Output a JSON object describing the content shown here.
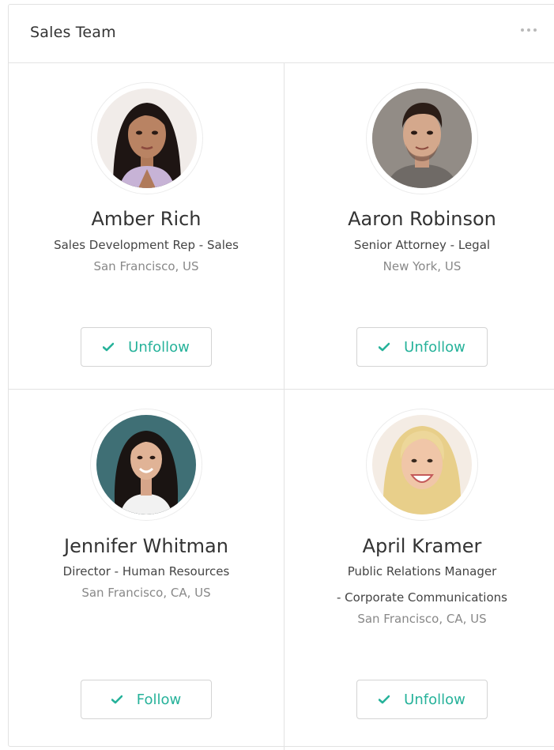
{
  "widget": {
    "title": "Sales Team",
    "menu_icon": "ellipsis-icon"
  },
  "colors": {
    "accent": "#26b29a",
    "border": "#e3e3e3",
    "text": "#333333",
    "muted": "#888888"
  },
  "people": [
    {
      "name": "Amber Rich",
      "role": "Sales Development Rep  -  Sales",
      "location": "San Francisco, US",
      "button": "Unfollow"
    },
    {
      "name": "Aaron Robinson",
      "role": "Senior Attorney  -  Legal",
      "location": "New York, US",
      "button": "Unfollow"
    },
    {
      "name": "Jennifer Whitman",
      "role": "Director  -  Human Resources",
      "location": "San Francisco, CA, US",
      "button": "Follow"
    },
    {
      "name": "April Kramer",
      "role": "Public Relations Manager",
      "role_2": "-  Corporate Communications",
      "location": "San Francisco, CA, US",
      "button": "Unfollow"
    }
  ]
}
